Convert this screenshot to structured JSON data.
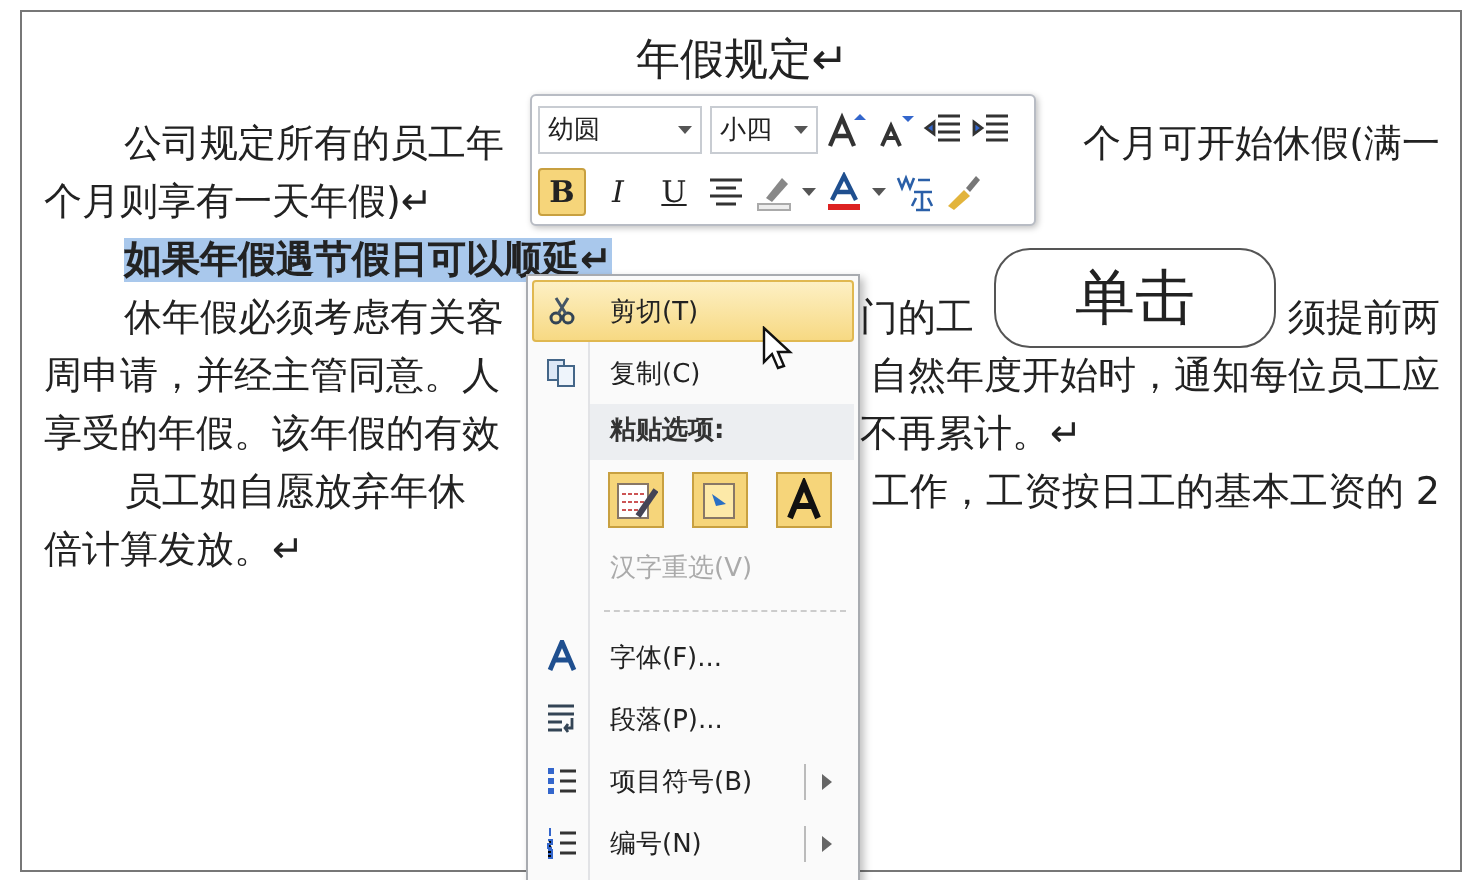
{
  "document": {
    "title": "年假规定↵",
    "lines": [
      {
        "indent": true,
        "highlighted": false,
        "paragraph_end": false,
        "left": "公司规定所有的员工年",
        "right": [
          "个月可开始休假(满一"
        ]
      },
      {
        "indent": false,
        "highlighted": false,
        "left": "个月则享有一天年假)↵"
      },
      {
        "indent": true,
        "highlighted": true,
        "left": "如果年假遇节假日可以顺延↵"
      },
      {
        "indent": true,
        "highlighted": false,
        "paragraph_end": false,
        "left": "休年假必须考虑有关客",
        "right": [
          "门的工",
          "须提前两"
        ]
      },
      {
        "indent": false,
        "highlighted": false,
        "paragraph_end": false,
        "left": "周申请，并经主管同意。人",
        "right": [
          "自然年度开始时，通知每位员工应"
        ]
      },
      {
        "indent": false,
        "highlighted": false,
        "paragraph_end": true,
        "left": "享受的年假。该年假的有效",
        "right": [
          "不再累计。↵"
        ]
      },
      {
        "indent": true,
        "highlighted": false,
        "paragraph_end": false,
        "left": "员工如自愿放弃年休",
        "right": [
          "工作，工资按日工的基本工资的 2"
        ]
      },
      {
        "indent": false,
        "highlighted": false,
        "left": "倍计算发放。↵"
      }
    ]
  },
  "mini_toolbar": {
    "font": "幼圆",
    "size": "小四",
    "format_buttons": [
      {
        "label": "B",
        "selected": true
      },
      {
        "label": "I",
        "selected": false
      },
      {
        "label": "U",
        "selected": false
      }
    ]
  },
  "context_menu": {
    "items": [
      {
        "kind": "item",
        "label": "剪切(T)",
        "selected": true,
        "disabled": false,
        "submenu": false
      },
      {
        "kind": "item",
        "label": "复制(C)",
        "selected": false,
        "disabled": false,
        "submenu": false
      },
      {
        "kind": "header",
        "label": "粘贴选项:"
      },
      {
        "kind": "paste_options"
      },
      {
        "kind": "item",
        "label": "汉字重选(V)",
        "selected": false,
        "disabled": true,
        "submenu": false
      },
      {
        "kind": "separator"
      },
      {
        "kind": "item",
        "label": "字体(F)...",
        "selected": false,
        "disabled": false,
        "submenu": false
      },
      {
        "kind": "item",
        "label": "段落(P)...",
        "selected": false,
        "disabled": false,
        "submenu": false
      },
      {
        "kind": "item",
        "label": "项目符号(B)",
        "selected": false,
        "disabled": false,
        "submenu": true
      },
      {
        "kind": "item",
        "label": "编号(N)",
        "selected": false,
        "disabled": false,
        "submenu": true
      }
    ]
  },
  "callout": {
    "text": "单击"
  }
}
